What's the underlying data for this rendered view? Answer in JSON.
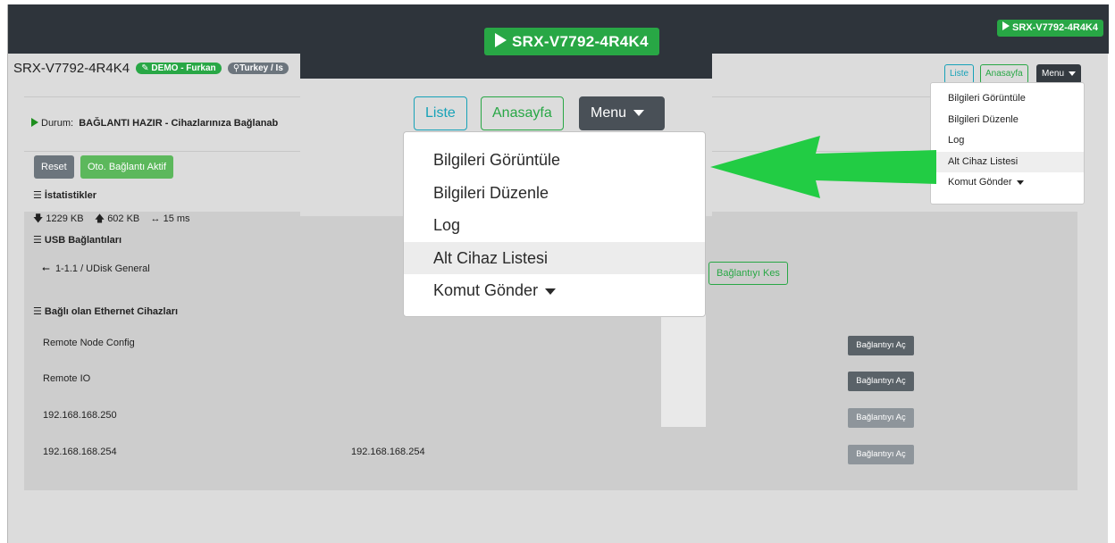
{
  "device_id": "SRX-V7792-4R4K4",
  "header": {
    "title": "SRX-V7792-4R4K4",
    "demo_badge": "DEMO - Furkan",
    "location_badge": "Turkey / Is"
  },
  "nav": {
    "list_label": "Liste",
    "home_label": "Anasayfa",
    "menu_label": "Menu"
  },
  "menu_items": [
    {
      "label": "Bilgileri Görüntüle"
    },
    {
      "label": "Bilgileri Düzenle"
    },
    {
      "label": "Log"
    },
    {
      "label": "Alt Cihaz Listesi",
      "active": true
    },
    {
      "label": "Komut Gönder",
      "has_submenu": true
    }
  ],
  "status": {
    "label": "Durum:",
    "value": "BAĞLANTI HAZIR - Cihazlarınıza Bağlanab"
  },
  "actions": {
    "reset_label": "Reset",
    "auto_connect_label": "Oto. Bağlantı Aktif"
  },
  "stats": {
    "title": "İstatistikler",
    "down": "1229 KB",
    "up": "602 KB",
    "latency": "15 ms"
  },
  "usb": {
    "title": "USB Bağlantıları",
    "device": "1-1.1 / UDisk General",
    "disconnect_label": "Bağlantıyı Kes"
  },
  "ethernet": {
    "title": "Bağlı olan Ethernet Cihazları",
    "rows": [
      {
        "name": "Remote Node Config",
        "ip": "",
        "button": "Bağlantıyı Aç",
        "enabled": true
      },
      {
        "name": "Remote IO",
        "ip": "",
        "button": "Bağlantıyı Aç",
        "enabled": true
      },
      {
        "name": "192.168.168.250",
        "ip": "",
        "button": "Bağlantıyı Aç",
        "enabled": false
      },
      {
        "name": "192.168.168.254",
        "ip": "192.168.168.254",
        "button": "Bağlantıyı Aç",
        "enabled": false
      }
    ]
  },
  "colors": {
    "brand_green": "#28a745",
    "topbar": "#2e343b",
    "arrow": "#22cc44",
    "info": "#17a2b8"
  },
  "icons": {
    "play": "play-icon",
    "edit": "edit-icon",
    "location": "map-marker-icon",
    "list": "list-icon",
    "download": "arrow-down-icon",
    "upload": "arrow-up-icon",
    "latency": "arrows-horizontal-icon",
    "usb": "usb-icon",
    "caret": "caret-down-icon",
    "callout": "callout-arrow"
  }
}
